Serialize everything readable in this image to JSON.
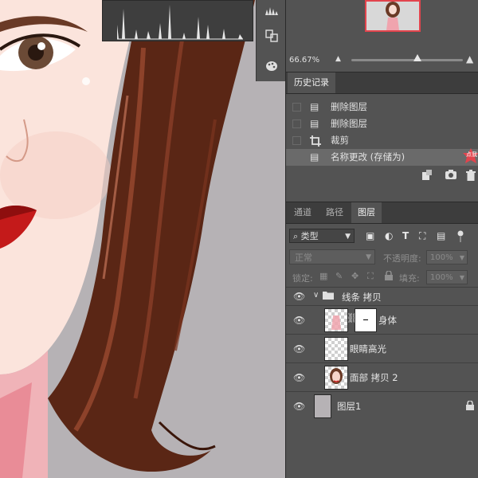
{
  "history": {
    "tab_label": "历史记录",
    "items": [
      {
        "label": "删除图层",
        "icon": "document-icon"
      },
      {
        "label": "删除图层",
        "icon": "document-icon"
      },
      {
        "label": "裁剪",
        "icon": "crop-icon"
      },
      {
        "label": "名称更改 (存储为)",
        "icon": "document-icon",
        "selected": true
      }
    ],
    "badge_text": "点我"
  },
  "navigator": {
    "zoom": "66.67%",
    "zoom_slider_value": 0.59
  },
  "layers_panel": {
    "tabs": [
      "通道",
      "路径",
      "图层"
    ],
    "active_tab": 2,
    "filter_label": "类型",
    "blend_mode": "正常",
    "opacity_label": "不透明度:",
    "opacity_value": "100%",
    "lock_label": "锁定:",
    "fill_label": "填充:",
    "fill_value": "100%",
    "layers": [
      {
        "name": "线条 拷贝",
        "type": "group"
      },
      {
        "name": "身体",
        "type": "masked"
      },
      {
        "name": "眼睛高光",
        "type": "pixel"
      },
      {
        "name": "面部 拷贝 2",
        "type": "pixel-face"
      },
      {
        "name": "图层1",
        "type": "locked"
      }
    ]
  },
  "colors": {
    "panel_bg": "#535353",
    "canvas_bg": "#b6b2b5",
    "accent_red": "#e2444d"
  }
}
